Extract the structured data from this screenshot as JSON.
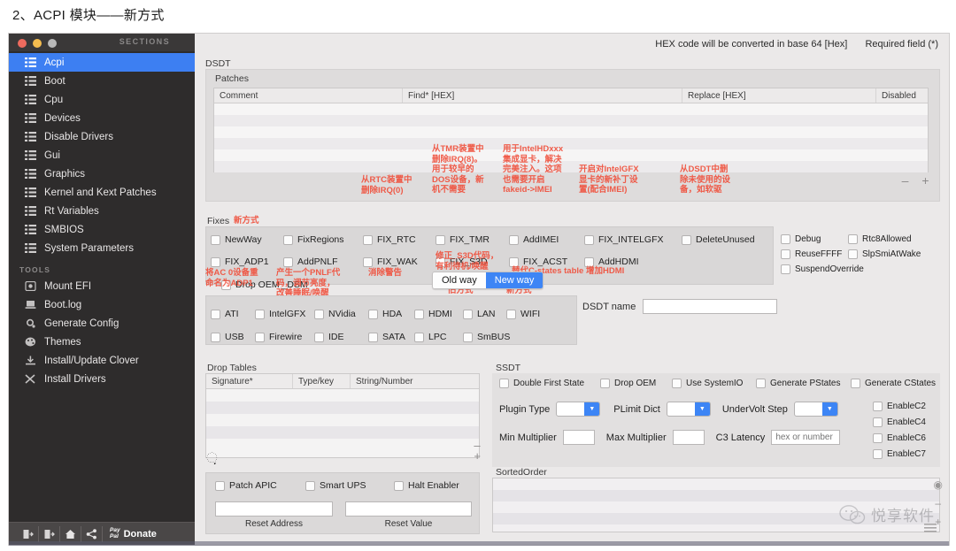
{
  "page": {
    "heading": "2、ACPI 模块——新方式"
  },
  "sidebar": {
    "sections_label": "SECTIONS",
    "tools_label": "TOOLS",
    "items": [
      {
        "label": "Acpi",
        "selected": true
      },
      {
        "label": "Boot",
        "selected": false
      },
      {
        "label": "Cpu",
        "selected": false
      },
      {
        "label": "Devices",
        "selected": false
      },
      {
        "label": "Disable Drivers",
        "selected": false
      },
      {
        "label": "Gui",
        "selected": false
      },
      {
        "label": "Graphics",
        "selected": false
      },
      {
        "label": "Kernel and Kext Patches",
        "selected": false
      },
      {
        "label": "Rt Variables",
        "selected": false
      },
      {
        "label": "SMBIOS",
        "selected": false
      },
      {
        "label": "System Parameters",
        "selected": false
      }
    ],
    "tools": [
      {
        "label": "Mount EFI",
        "icon": "disk-icon"
      },
      {
        "label": "Boot.log",
        "icon": "laptop-icon"
      },
      {
        "label": "Generate Config",
        "icon": "gear-icon"
      },
      {
        "label": "Themes",
        "icon": "palette-icon"
      },
      {
        "label": "Install/Update Clover",
        "icon": "download-icon"
      },
      {
        "label": "Install Drivers",
        "icon": "tools-icon"
      }
    ],
    "bottombar": {
      "donate_label": "Donate",
      "paypal_line1": "Pay",
      "paypal_line2": "Pal",
      "buttons": [
        "import-icon",
        "export-icon",
        "home-icon",
        "share-icon"
      ]
    }
  },
  "header": {
    "hex_note": "HEX code will be converted in base 64 [Hex]",
    "required_note": "Required field (*)"
  },
  "dsdt": {
    "label": "DSDT",
    "patches_label": "Patches",
    "columns": [
      "Comment",
      "Find* [HEX]",
      "Replace [HEX]",
      "Disabled"
    ],
    "rows": [],
    "remove_label": "–",
    "add_label": "+"
  },
  "fixes": {
    "label": "Fixes",
    "checkboxes": [
      {
        "label": "NewWay",
        "col": 0,
        "row": 0
      },
      {
        "label": "FixRegions",
        "col": 1,
        "row": 0
      },
      {
        "label": "FIX_RTC",
        "col": 2,
        "row": 0
      },
      {
        "label": "FIX_TMR",
        "col": 3,
        "row": 0
      },
      {
        "label": "AddIMEI",
        "col": 4,
        "row": 0
      },
      {
        "label": "FIX_INTELGFX",
        "col": 5,
        "row": 0
      },
      {
        "label": "DeleteUnused",
        "col": 6,
        "row": 0
      },
      {
        "label": "FIX_ADP1",
        "col": 0,
        "row": 1
      },
      {
        "label": "AddPNLF",
        "col": 1,
        "row": 1
      },
      {
        "label": "FIX_WAK",
        "col": 2,
        "row": 1
      },
      {
        "label": "FIX_S3D",
        "col": 3,
        "row": 1
      },
      {
        "label": "FIX_ACST",
        "col": 4,
        "row": 1
      },
      {
        "label": "AddHDMI",
        "col": 5,
        "row": 1
      },
      {
        "label": "Drop OEM _DSM",
        "col": 0,
        "row": 2
      }
    ],
    "right_checkboxes": [
      {
        "label": "Debug"
      },
      {
        "label": "Rtc8Allowed"
      },
      {
        "label": "ReuseFFFF"
      },
      {
        "label": "SlpSmiAtWake"
      },
      {
        "label": "SuspendOverride"
      }
    ],
    "segmented": {
      "old_way": "Old way",
      "new_way": "New way",
      "selected": "New way"
    },
    "annotations": [
      {
        "id": "anno-newway",
        "text": "新方式"
      },
      {
        "id": "anno-fixrtc",
        "text": "从RTC装置中\n删除IRQ(0)"
      },
      {
        "id": "anno-fixtmr",
        "text": "从TMR装置中\n删除IRQ(8)。\n用于较早的\nDOS设备，新\n机不需要"
      },
      {
        "id": "anno-addimei",
        "text": "用于IntelHDxxx\n集成显卡，解决\n完美注入。这项\n也需要开启\nfakeid->IMEI"
      },
      {
        "id": "anno-intelgfx",
        "text": "开启对IntelGFX\n显卡的新补丁设\n置(配合IMEI)"
      },
      {
        "id": "anno-deleteunused",
        "text": "从DSDT中删\n除未使用的设\n备，如软驱"
      },
      {
        "id": "anno-fixadp1",
        "text": "将AC 0设备重\n命名为ADP1"
      },
      {
        "id": "anno-addpnlf",
        "text": "产生一个PNLF代\n码，调节亮度，\n改善睡眠/唤醒"
      },
      {
        "id": "anno-fixwak",
        "text": "消除警告"
      },
      {
        "id": "anno-fixs3d",
        "text": "修正_S3D代码，\n有利待机/唤醒"
      },
      {
        "id": "anno-fixacst",
        "text": "替代C-states table"
      },
      {
        "id": "anno-addhdmi",
        "text": "增加HDMI"
      },
      {
        "id": "anno-oldway",
        "text": "旧方式"
      },
      {
        "id": "anno-newway2",
        "text": "新方式"
      }
    ]
  },
  "devices": {
    "row1": [
      "ATI",
      "IntelGFX",
      "NVidia",
      "HDA",
      "HDMI",
      "LAN",
      "WIFI"
    ],
    "row2": [
      "USB",
      "Firewire",
      "IDE",
      "SATA",
      "LPC",
      "SmBUS"
    ],
    "dsdt_name_label": "DSDT name",
    "dsdt_name_value": ""
  },
  "drop_tables": {
    "label": "Drop Tables",
    "columns": [
      "Signature*",
      "Type/key",
      "String/Number"
    ],
    "rows": [],
    "remove_label": "–",
    "add_label": "+"
  },
  "ssdt": {
    "label": "SSDT",
    "checkboxes": [
      "Double First State",
      "Drop OEM",
      "Use SystemIO",
      "Generate PStates",
      "Generate CStates"
    ],
    "plugin_type_label": "Plugin Type",
    "plugin_type_value": "",
    "plimit_dict_label": "PLimit Dict",
    "plimit_dict_value": "",
    "undervolt_step_label": "UnderVolt Step",
    "undervolt_step_value": "",
    "min_multiplier_label": "Min Multiplier",
    "min_multiplier_value": "",
    "max_multiplier_label": "Max Multiplier",
    "max_multiplier_value": "",
    "c3_latency_label": "C3 Latency",
    "c3_latency_placeholder": "hex or number",
    "c3_latency_value": "",
    "enable_c": [
      "EnableC2",
      "EnableC4",
      "EnableC6",
      "EnableC7"
    ]
  },
  "bottom_left": {
    "checkboxes": [
      "Patch APIC",
      "Smart UPS",
      "Halt Enabler"
    ],
    "reset_address_label": "Reset Address",
    "reset_address_value": "",
    "reset_value_label": "Reset Value",
    "reset_value_value": ""
  },
  "sorted_order": {
    "label": "SortedOrder",
    "rows": [],
    "eye_label": "◉",
    "remove_label": "–",
    "add_label": "+"
  },
  "watermark": {
    "text": "悦享软件"
  },
  "colors": {
    "accent_blue": "#3d7ff2",
    "annotation_red": "#f0503c",
    "sidebar_bg": "#2e2c2c",
    "panel_bg": "#ebe9e9"
  }
}
